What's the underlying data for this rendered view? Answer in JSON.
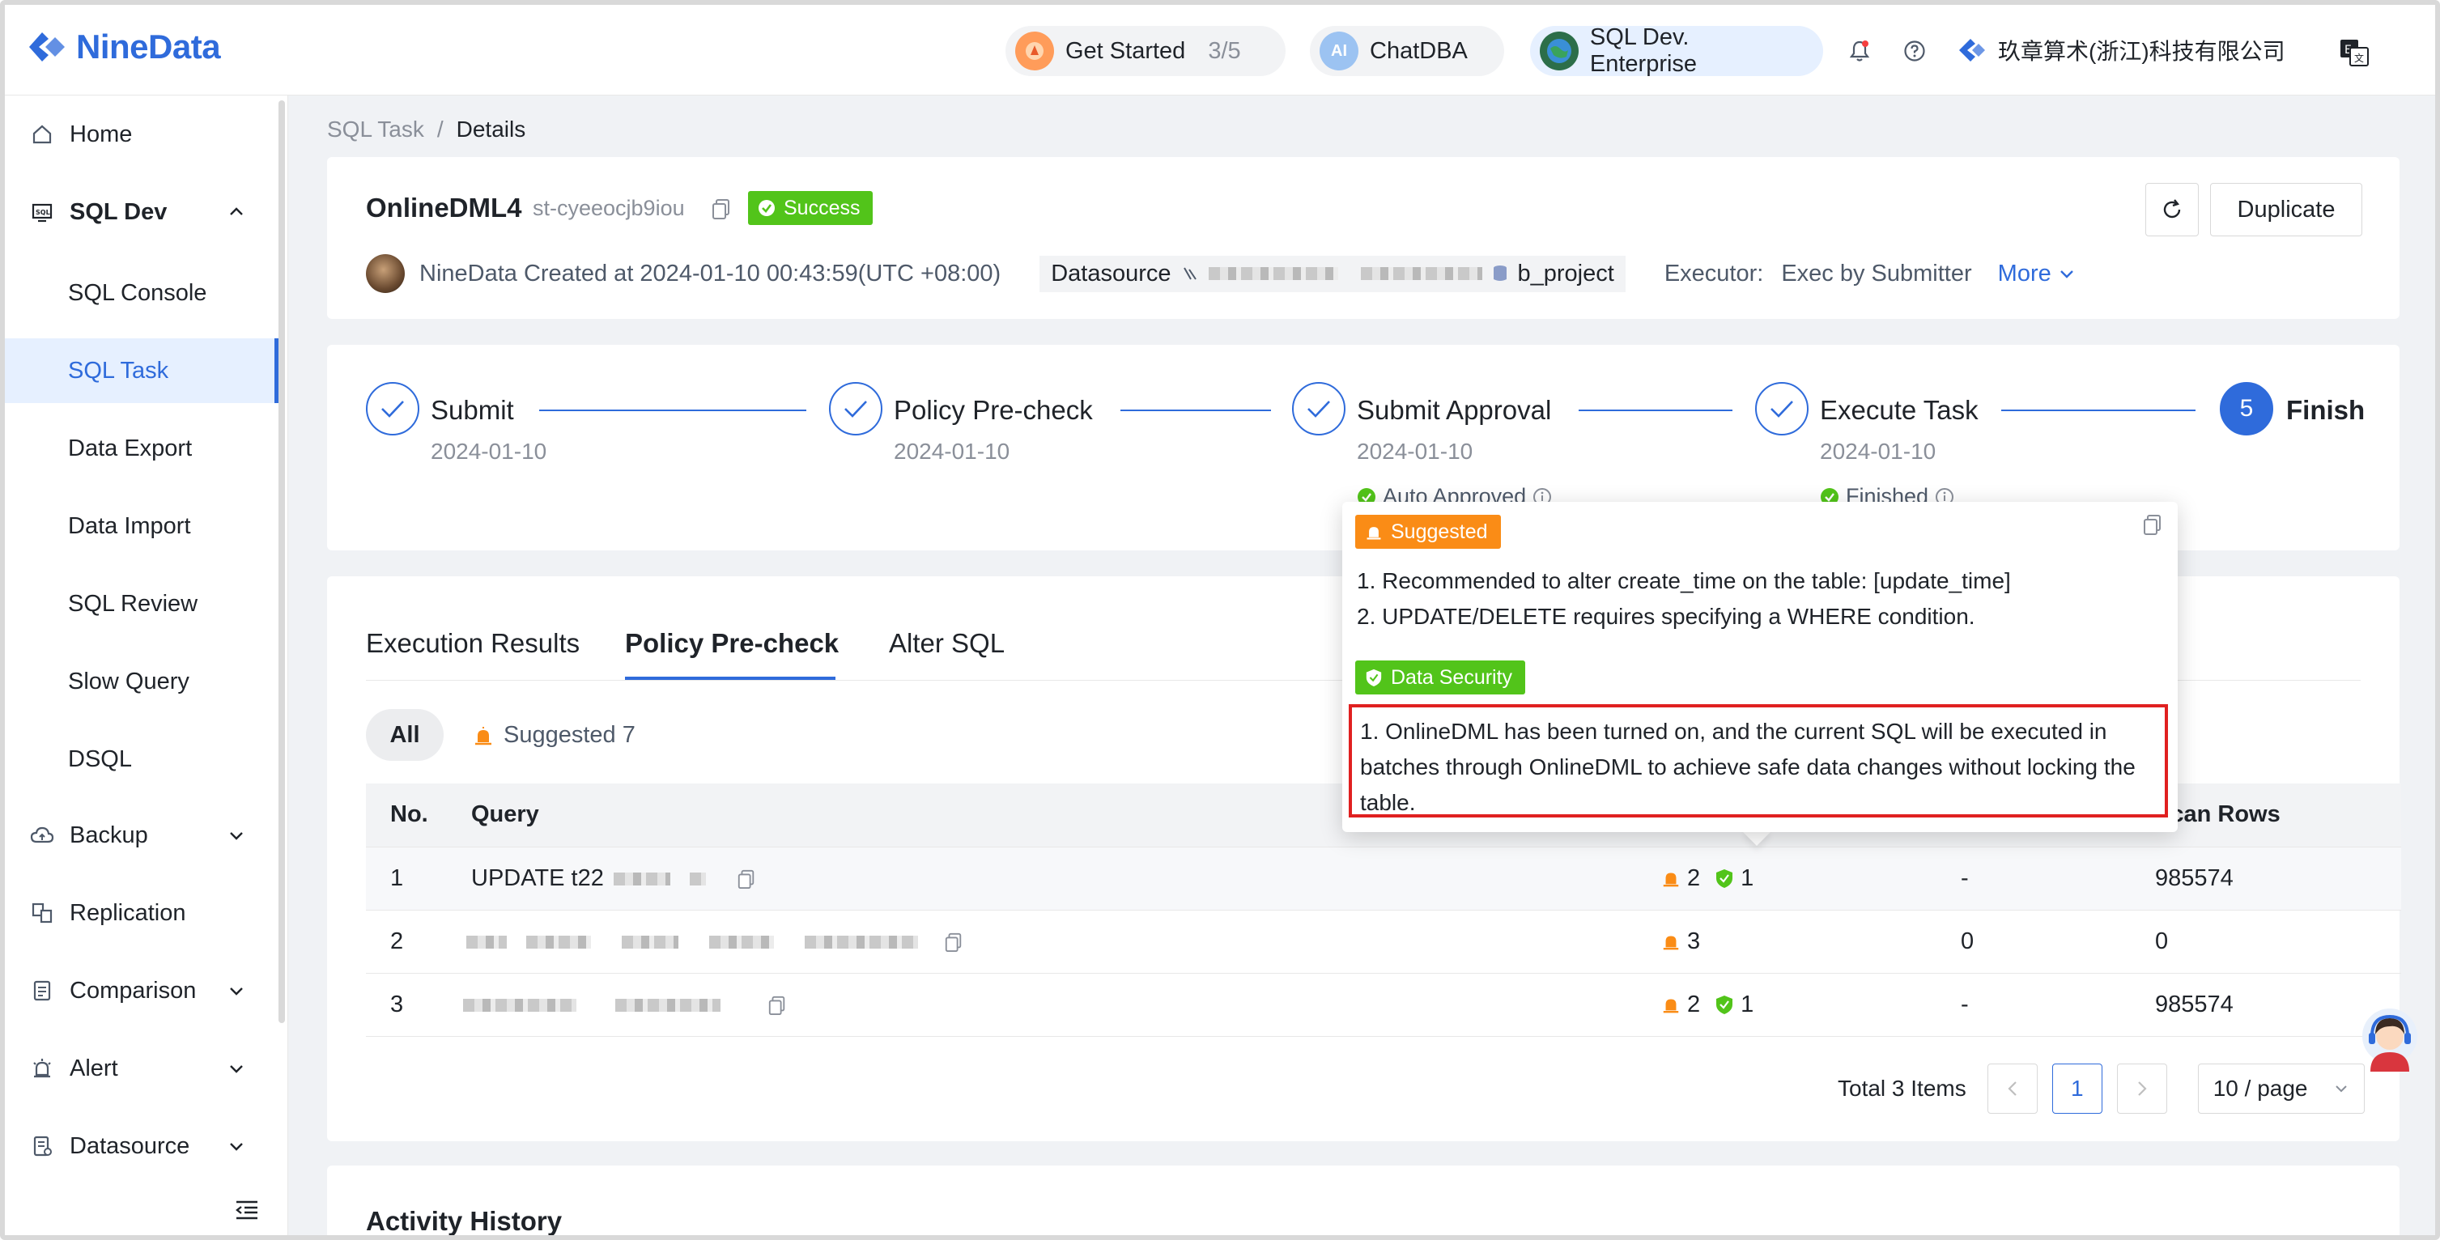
{
  "header": {
    "logo": "NineData",
    "get_started": "Get Started",
    "get_started_progress": "3/5",
    "chatdba": "ChatDBA",
    "chatdba_badge": "AI",
    "edition": "SQL Dev. Enterprise",
    "company": "玖章算术(浙江)科技有限公司"
  },
  "sidebar": {
    "items": [
      {
        "label": "Home"
      },
      {
        "label": "SQL Dev"
      },
      {
        "label": "SQL Console"
      },
      {
        "label": "SQL Task"
      },
      {
        "label": "Data Export"
      },
      {
        "label": "Data Import"
      },
      {
        "label": "SQL Review"
      },
      {
        "label": "Slow Query"
      },
      {
        "label": "DSQL"
      },
      {
        "label": "Backup"
      },
      {
        "label": "Replication"
      },
      {
        "label": "Comparison"
      },
      {
        "label": "Alert"
      },
      {
        "label": "Datasource"
      }
    ]
  },
  "breadcrumb": {
    "parent": "SQL Task",
    "sep": "/",
    "current": "Details"
  },
  "task": {
    "name": "OnlineDML4",
    "id": "st-cyeeocjb9iou",
    "status": "Success",
    "creator_line": "NineData Created at 2024-01-10 00:43:59(UTC +08:00)",
    "datasource_label": "Datasource",
    "database": "b_project",
    "executor_label": "Executor:",
    "executor_value": "Exec by Submitter",
    "more": "More",
    "duplicate": "Duplicate"
  },
  "steps": [
    {
      "title": "Submit",
      "date": "2024-01-10"
    },
    {
      "title": "Policy Pre-check",
      "date": "2024-01-10"
    },
    {
      "title": "Submit Approval",
      "date": "2024-01-10",
      "status": "Auto Approved"
    },
    {
      "title": "Execute Task",
      "date": "2024-01-10",
      "status": "Finished"
    },
    {
      "title": "Finish",
      "number": "5"
    }
  ],
  "tabs": [
    "Execution Results",
    "Policy Pre-check",
    "Alter SQL"
  ],
  "filters": {
    "all": "All",
    "suggested": "Suggested 7"
  },
  "table": {
    "headers": {
      "no": "No.",
      "query": "Query",
      "scan_rows": "Scan Rows"
    },
    "rows": [
      {
        "no": "1",
        "query": "UPDATE t22",
        "warn": "2",
        "sec": "1",
        "col5": "-",
        "scan": "985574"
      },
      {
        "no": "2",
        "query": "",
        "warn": "3",
        "sec": "",
        "col5": "0",
        "scan": "0"
      },
      {
        "no": "3",
        "query": "",
        "warn": "2",
        "sec": "1",
        "col5": "-",
        "scan": "985574"
      }
    ]
  },
  "pagination": {
    "total": "Total 3 Items",
    "page": "1",
    "page_size": "10 / page"
  },
  "popover": {
    "suggested_tag": "Suggested",
    "suggested_items": [
      "1. Recommended to alter create_time on the table: [update_time]",
      "2. UPDATE/DELETE requires specifying a WHERE condition."
    ],
    "security_tag": "Data Security",
    "security_item": "1. OnlineDML has been turned on, and the current SQL will be executed in batches through OnlineDML to achieve safe data changes without locking the table."
  },
  "activity": {
    "title": "Activity History"
  },
  "colors": {
    "accent": "#2f6bdb",
    "success": "#52c41a",
    "warning": "#fa8c16",
    "highlight": "#e02020"
  }
}
